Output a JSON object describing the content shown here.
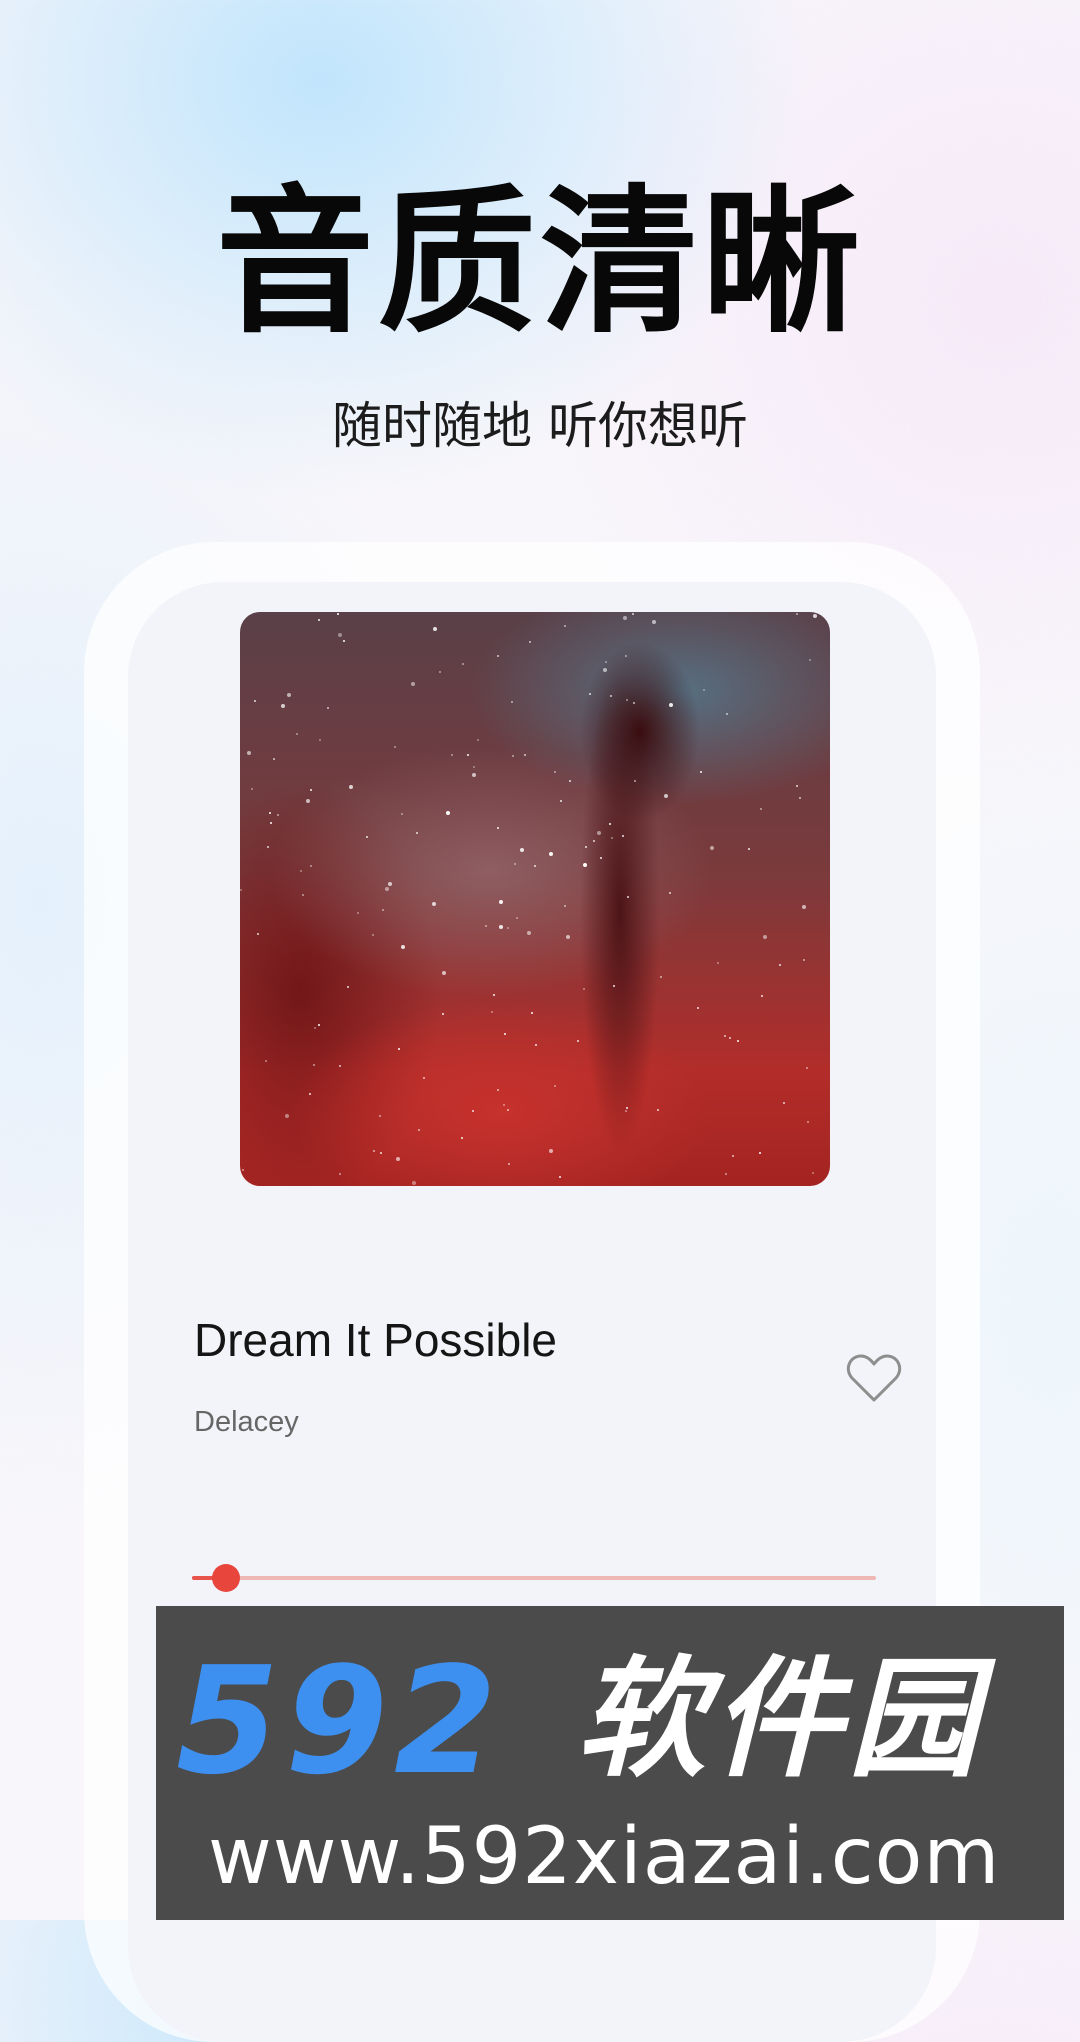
{
  "header": {
    "title": "音质清晰",
    "subtitle": "随时随地 听你想听"
  },
  "player": {
    "song_title": "Dream It Possible",
    "artist": "Delacey",
    "favorite_icon": "heart-outline-icon",
    "progress_fraction": 0.05,
    "accent_color": "#e8453d"
  },
  "watermark": {
    "number": "592",
    "name": "软件园",
    "url": "www.592xiazai.com",
    "number_color": "#3d8ff0",
    "background_color": "#4b4b4b"
  }
}
